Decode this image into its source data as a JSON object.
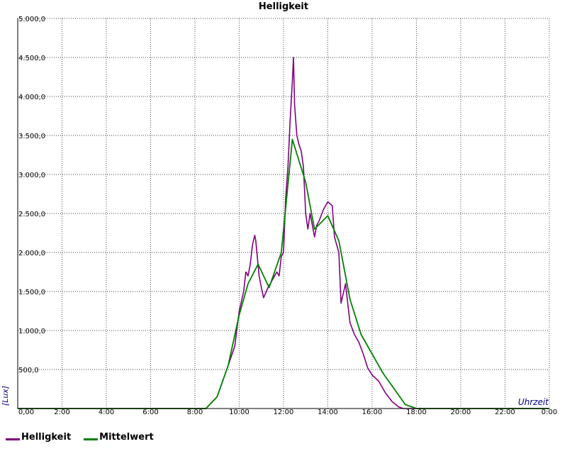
{
  "chart_data": {
    "type": "line",
    "title": "Helligkeit",
    "xlabel": "Uhrzeit",
    "ylabel": "[Lux]",
    "x_ticks": [
      "0,00",
      "2:00",
      "4:00",
      "6:00",
      "8:00",
      "10:00",
      "12:00",
      "14:00",
      "16:00",
      "18:00",
      "20:00",
      "22:00",
      "0:00"
    ],
    "y_ticks": [
      "500,0",
      "1.000,0",
      "1.500,0",
      "2.000,0",
      "2.500,0",
      "3.000,0",
      "3.500,0",
      "4.000,0",
      "4.500,0",
      "5.000,0"
    ],
    "xlim": [
      0,
      24
    ],
    "ylim": [
      0,
      5000
    ],
    "grid": true,
    "legend_position": "bottom-left",
    "series": [
      {
        "name": "Helligkeit",
        "color": "#800080",
        "x": [
          0,
          8.5,
          9.0,
          9.5,
          9.8,
          10.0,
          10.2,
          10.3,
          10.4,
          10.5,
          10.6,
          10.7,
          10.75,
          10.9,
          11.0,
          11.1,
          11.3,
          11.5,
          11.7,
          11.8,
          11.9,
          12.0,
          12.1,
          12.2,
          12.3,
          12.4,
          12.45,
          12.5,
          12.6,
          12.7,
          12.8,
          12.9,
          13.0,
          13.1,
          13.2,
          13.4,
          13.5,
          13.6,
          13.8,
          14.0,
          14.2,
          14.3,
          14.5,
          14.6,
          14.8,
          15.0,
          15.2,
          15.4,
          15.6,
          15.8,
          16.0,
          16.3,
          16.6,
          16.9,
          17.2,
          17.4,
          17.6,
          17.8,
          18.0,
          24
        ],
        "y": [
          0,
          0,
          150,
          550,
          800,
          1250,
          1500,
          1750,
          1700,
          1850,
          2100,
          2220,
          2150,
          1700,
          1550,
          1420,
          1550,
          1650,
          1750,
          1700,
          1950,
          2000,
          2700,
          3100,
          3700,
          4200,
          4500,
          3900,
          3500,
          3380,
          3300,
          3100,
          2500,
          2300,
          2500,
          2200,
          2350,
          2400,
          2550,
          2650,
          2600,
          2200,
          2000,
          1350,
          1600,
          1100,
          950,
          850,
          700,
          520,
          430,
          350,
          200,
          90,
          20,
          0,
          0,
          0,
          0,
          0
        ]
      },
      {
        "name": "Mittelwert",
        "color": "#008000",
        "x": [
          0,
          8.5,
          9.0,
          9.5,
          10.0,
          10.4,
          10.85,
          11.35,
          11.9,
          12.4,
          13.0,
          13.4,
          14.0,
          14.5,
          15.0,
          15.5,
          16.0,
          16.5,
          17.0,
          17.5,
          18.0,
          24
        ],
        "y": [
          0,
          0,
          150,
          550,
          1200,
          1600,
          1850,
          1550,
          2000,
          3450,
          2900,
          2300,
          2470,
          2150,
          1400,
          950,
          700,
          450,
          250,
          50,
          0,
          0
        ]
      }
    ]
  }
}
